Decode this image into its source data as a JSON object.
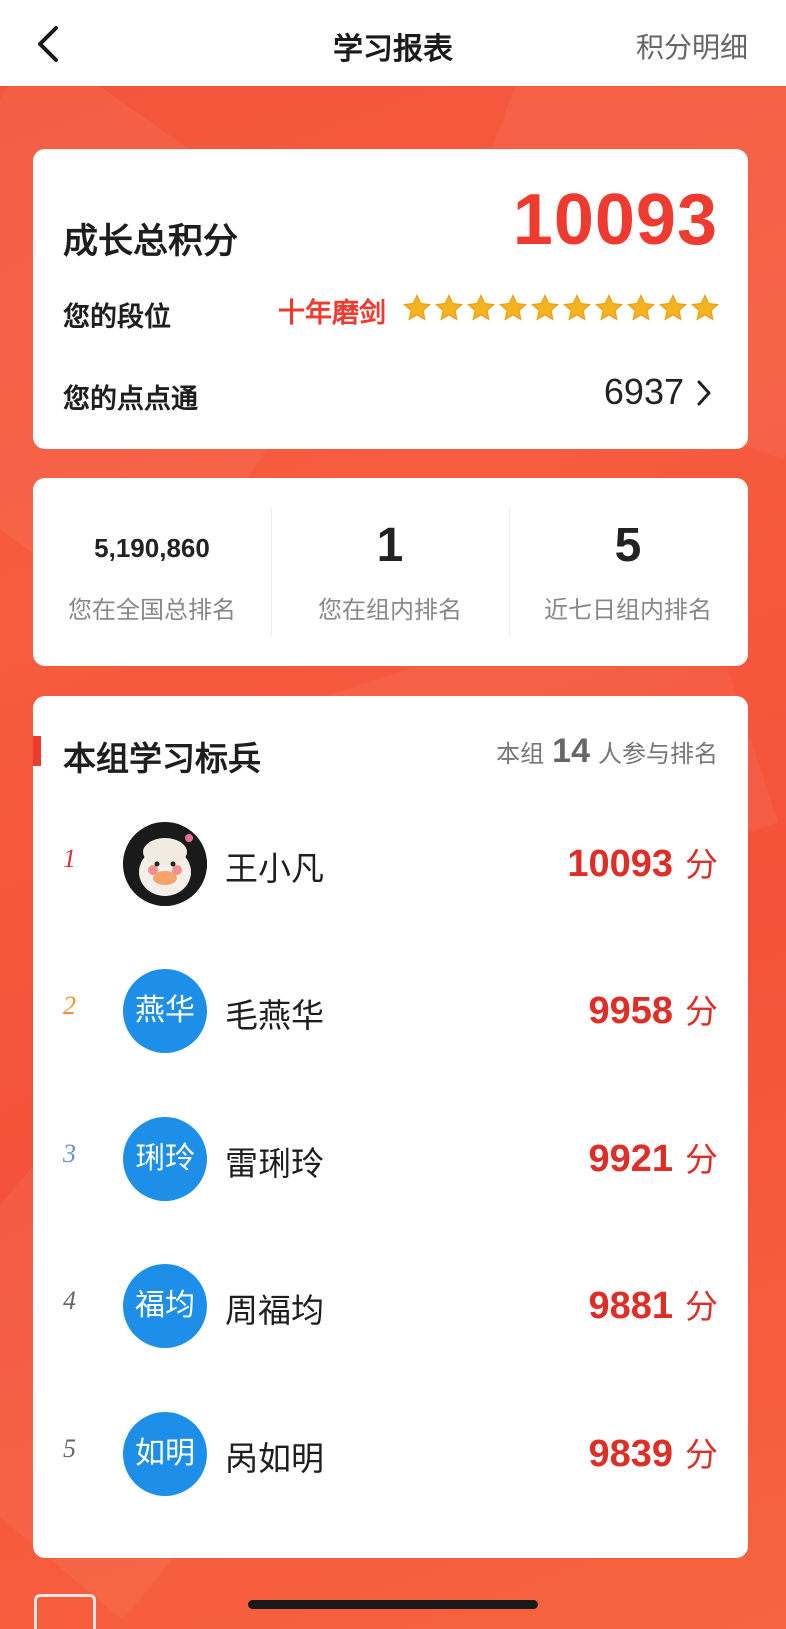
{
  "nav": {
    "title": "学习报表",
    "right_label": "积分明细"
  },
  "summary": {
    "total_label": "成长总积分",
    "total_value": "10093",
    "rank_label": "您的段位",
    "rank_value": "十年磨剑",
    "star_count": 10,
    "points_label": "您的点点通",
    "points_value": "6937"
  },
  "stats": [
    {
      "value": "5,190,860",
      "caption": "您在全国总排名"
    },
    {
      "value": "1",
      "caption": "您在组内排名"
    },
    {
      "value": "5",
      "caption": "近七日组内排名"
    }
  ],
  "leaderboard": {
    "title": "本组学习标兵",
    "meta_prefix": "本组",
    "meta_count": "14",
    "meta_suffix": "人参与排名",
    "rows": [
      {
        "rank": "1",
        "avatar": "",
        "name": "王小凡",
        "score": "10093",
        "unit": "分",
        "rank_color": "#d8302b"
      },
      {
        "rank": "2",
        "avatar": "燕华",
        "name": "毛燕华",
        "score": "9958",
        "unit": "分",
        "rank_color": "#f0922f"
      },
      {
        "rank": "3",
        "avatar": "琍玲",
        "name": "雷琍玲",
        "score": "9921",
        "unit": "分",
        "rank_color": "#6a8fd0"
      },
      {
        "rank": "4",
        "avatar": "福均",
        "name": "周福均",
        "score": "9881",
        "unit": "分",
        "rank_color": "#666666"
      },
      {
        "rank": "5",
        "avatar": "如明",
        "name": "呙如明",
        "score": "9839",
        "unit": "分",
        "rank_color": "#666666"
      }
    ]
  },
  "colors": {
    "accent": "#ee3a2f",
    "background": "#f5553a",
    "avatar": "#1d8fe8",
    "star": "#f7b21f"
  }
}
